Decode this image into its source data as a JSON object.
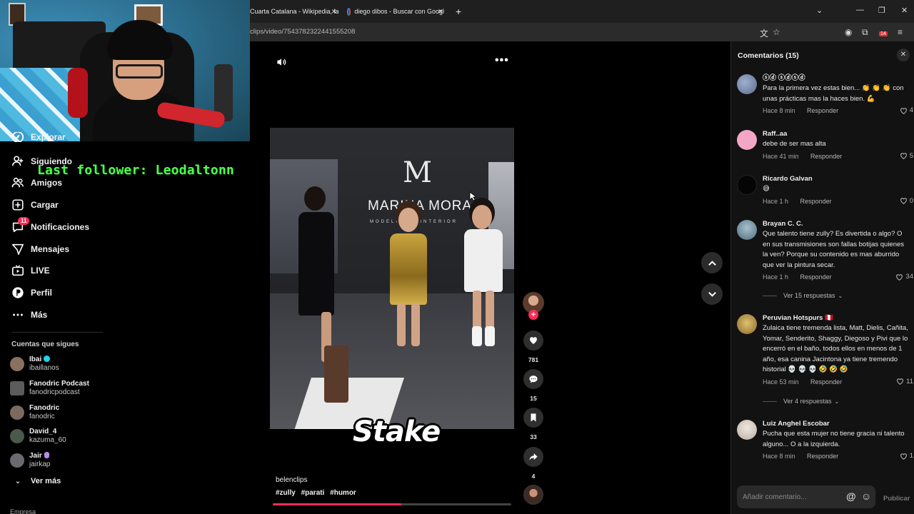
{
  "overlay": {
    "last_follower": "Last follower: Leodaltonn"
  },
  "sidebar": {
    "items": [
      {
        "label": "Explorar",
        "icon": "compass-icon"
      },
      {
        "label": "Siguiendo",
        "icon": "user-follow-icon"
      },
      {
        "label": "Amigos",
        "icon": "friends-icon"
      },
      {
        "label": "Cargar",
        "icon": "upload-plus-icon"
      },
      {
        "label": "Notificaciones",
        "icon": "notification-icon",
        "badge": "11"
      },
      {
        "label": "Mensajes",
        "icon": "send-icon"
      },
      {
        "label": "LIVE",
        "icon": "live-tv-icon"
      },
      {
        "label": "Perfil",
        "icon": "profile-icon"
      },
      {
        "label": "Más",
        "icon": "more-dots-icon"
      }
    ],
    "following_header": "Cuentas que sigues",
    "following": [
      {
        "name": "Ibai",
        "user": "ibaillanos",
        "verified": true,
        "color": "#8a7060"
      },
      {
        "name": "Fanodric Podcast",
        "user": "fanodricpodcast",
        "verified": false,
        "color": "#5b5b5b"
      },
      {
        "name": "Fanodric",
        "user": "fanodric",
        "verified": false,
        "color": "#7a6a60"
      },
      {
        "name": "David_4",
        "user": "kazuma_60",
        "verified": false,
        "color": "#4a5a4a"
      },
      {
        "name": "Jair",
        "user": "jairkap",
        "verified": false,
        "purple": true,
        "color": "#6a6a70"
      }
    ],
    "see_more": "Ver más",
    "footer": "Empresa"
  },
  "browser": {
    "tabs": [
      {
        "title": "Cuarta Catalana - Wikipedia, la"
      },
      {
        "title": "diego dibos - Buscar con Googl"
      }
    ],
    "new_tab": "+",
    "url": "clips/video/7543782322441555208",
    "ext_badge": "14"
  },
  "video": {
    "logo_letter": "M",
    "logo_text": "MARINA MORA",
    "logo_sub": "MODELING · INTERIOR",
    "sponsor": "Stake",
    "author": "belenclips",
    "hashtags": [
      "#zully",
      "#parati",
      "#humor"
    ],
    "progress": 0.54,
    "likes": "781",
    "comments": "15",
    "saves": "33",
    "shares": "4"
  },
  "comments_panel": {
    "title": "Comentarios (15)",
    "items": [
      {
        "user": "ⓢⓓ ⓢⓓⓢⓓ",
        "text": "Para la primera vez estas bien... 👏 👏 👏 con unas prácticas mas la haces bien. 💪",
        "time": "Hace 8 min",
        "reply": "Responder",
        "likes": "4",
        "color": "#6f7fa0"
      },
      {
        "user": "Raff..aa",
        "text": "debe de ser mas alta",
        "time": "Hace 41 min",
        "reply": "Responder",
        "likes": "5",
        "color": "#f3a6c6"
      },
      {
        "user": "Ricardo Galvan",
        "text": "😅",
        "time": "Hace 1 h",
        "reply": "Responder",
        "likes": "0",
        "color": "#050505"
      },
      {
        "user": "Brayan C. C.",
        "text": "Que talento tiene zully? Es divertida o algo? O en sus transmisiones son fallas botijas quienes la ven? Porque su contenido es mas aburrido que ver la pintura secar.",
        "time": "Hace 1 h",
        "reply": "Responder",
        "likes": "34",
        "color": "#6e8a9a",
        "replies": "Ver 15 respuestas"
      },
      {
        "user": "Peruvian Hotspurs 🇵🇪",
        "text": "Zulaica tiene tremenda lista, Matt, Dielis, Cañita, Yomar, Senderito, Shaggy, Diegoso y Pivi que lo encerró en el baño, todos ellos en menos de 1 año, esa canina Jacintona ya tiene tremendo historial 💀 💀 💀 🤣 🤣 🤣",
        "time": "Hace 53 min",
        "reply": "Responder",
        "likes": "11",
        "color": "#b08a3c",
        "replies": "Ver 4 respuestas"
      },
      {
        "user": "Luiz Anghel Escobar",
        "text": "Pucha que esta mujer no tiene gracia ni talento alguno... O a la izquierda.",
        "time": "Hace 8 min",
        "reply": "Responder",
        "likes": "1",
        "color": "#d8d0c8"
      }
    ],
    "input_placeholder": "Añadir comentario...",
    "publish": "Publicar"
  }
}
